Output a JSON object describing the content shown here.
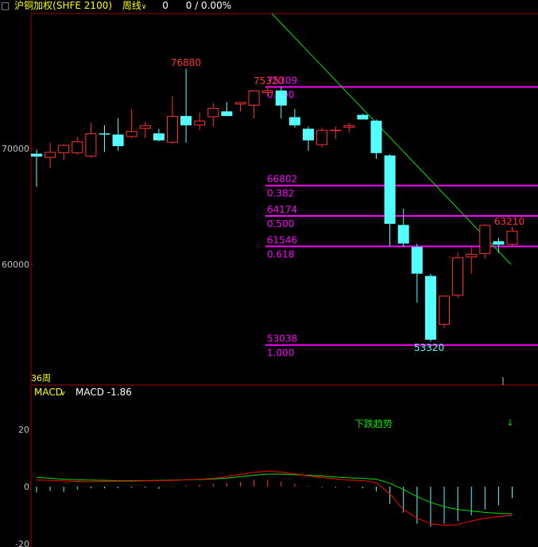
{
  "header": {
    "menu_glyph": "□",
    "symbol": "沪铜加权(SHFE 2100)",
    "period": "周线",
    "period_arrow": "chevron-down-icon",
    "volume": "0",
    "change": "0 / 0.00%"
  },
  "main": {
    "y_tick_labels": [
      "70000",
      "60000"
    ],
    "y_tick_values": [
      70000,
      60000
    ],
    "period_count_label": "36周",
    "annotations": {
      "high_label": "76880",
      "peak_label": "75320",
      "low_label": "53320",
      "last_label": "63210"
    }
  },
  "fib": [
    {
      "price": "75309",
      "ratio": "0.000",
      "value": 75309
    },
    {
      "price": "66802",
      "ratio": "0.382",
      "value": 66802
    },
    {
      "price": "64174",
      "ratio": "0.500",
      "value": 64174
    },
    {
      "price": "61546",
      "ratio": "0.618",
      "value": 61546
    },
    {
      "price": "53038",
      "ratio": "1.000",
      "value": 53038
    }
  ],
  "candles": [
    {
      "o": 69550,
      "h": 69900,
      "l": 66700,
      "c": 69300
    },
    {
      "o": 69200,
      "h": 70500,
      "l": 68300,
      "c": 69700
    },
    {
      "o": 69600,
      "h": 70400,
      "l": 69000,
      "c": 70300
    },
    {
      "o": 69600,
      "h": 71000,
      "l": 69500,
      "c": 70600
    },
    {
      "o": 69300,
      "h": 72200,
      "l": 69200,
      "c": 71300
    },
    {
      "o": 71300,
      "h": 72000,
      "l": 69700,
      "c": 71200
    },
    {
      "o": 71200,
      "h": 72600,
      "l": 69800,
      "c": 70200
    },
    {
      "o": 71000,
      "h": 73400,
      "l": 70900,
      "c": 71500
    },
    {
      "o": 71700,
      "h": 72300,
      "l": 70900,
      "c": 72000
    },
    {
      "o": 71300,
      "h": 71700,
      "l": 70600,
      "c": 70700
    },
    {
      "o": 70500,
      "h": 74500,
      "l": 70400,
      "c": 72800
    },
    {
      "o": 72800,
      "h": 76880,
      "l": 70500,
      "c": 72000
    },
    {
      "o": 72000,
      "h": 73100,
      "l": 71600,
      "c": 72400
    },
    {
      "o": 72700,
      "h": 73900,
      "l": 71900,
      "c": 73500
    },
    {
      "o": 73200,
      "h": 74000,
      "l": 72800,
      "c": 72800
    },
    {
      "o": 73800,
      "h": 74000,
      "l": 73200,
      "c": 74000
    },
    {
      "o": 73700,
      "h": 75000,
      "l": 72600,
      "c": 75000
    },
    {
      "o": 74800,
      "h": 75320,
      "l": 74600,
      "c": 75000
    },
    {
      "o": 75000,
      "h": 75300,
      "l": 72600,
      "c": 73700
    },
    {
      "o": 72700,
      "h": 73400,
      "l": 71800,
      "c": 72000
    },
    {
      "o": 71700,
      "h": 71900,
      "l": 69800,
      "c": 70700
    },
    {
      "o": 70300,
      "h": 71800,
      "l": 70100,
      "c": 71600
    },
    {
      "o": 71600,
      "h": 71900,
      "l": 70800,
      "c": 71600
    },
    {
      "o": 71800,
      "h": 72200,
      "l": 71400,
      "c": 72000
    },
    {
      "o": 72900,
      "h": 73000,
      "l": 72500,
      "c": 72500
    },
    {
      "o": 72400,
      "h": 72500,
      "l": 69100,
      "c": 69600
    },
    {
      "o": 69400,
      "h": 69500,
      "l": 61600,
      "c": 63500
    },
    {
      "o": 63400,
      "h": 64800,
      "l": 61500,
      "c": 61800
    },
    {
      "o": 61500,
      "h": 61800,
      "l": 56700,
      "c": 59200
    },
    {
      "o": 59000,
      "h": 59200,
      "l": 53320,
      "c": 53500
    },
    {
      "o": 54800,
      "h": 57300,
      "l": 54500,
      "c": 57300
    },
    {
      "o": 57300,
      "h": 61000,
      "l": 57100,
      "c": 60600
    },
    {
      "o": 60600,
      "h": 61600,
      "l": 59200,
      "c": 60900
    },
    {
      "o": 60900,
      "h": 63500,
      "l": 60500,
      "c": 63400
    },
    {
      "o": 62000,
      "h": 62300,
      "l": 61000,
      "c": 61700
    },
    {
      "o": 61700,
      "h": 63210,
      "l": 61600,
      "c": 62900
    }
  ],
  "macd": {
    "label": "MACD",
    "label_arrow": "chevron-down-icon",
    "value_text": "MACD -1.86",
    "y_tick_labels": [
      "20",
      "0",
      "-20"
    ],
    "y_tick_values": [
      20,
      0,
      -20
    ],
    "signal_text": "下跌趋势",
    "signal_icon": "arrow-down-icon",
    "hist": [
      -2,
      -1.5,
      -1.8,
      -1,
      -0.6,
      -0.6,
      -0.5,
      -0.4,
      -0.4,
      -0.8,
      0.2,
      0.5,
      0.8,
      1,
      1.3,
      1.6,
      2.4,
      2.4,
      1.8,
      1,
      0.3,
      -0.2,
      -0.3,
      -0.3,
      -0.6,
      -1.6,
      -6,
      -9,
      -13,
      -14,
      -13,
      -12,
      -10,
      -8,
      -6.5,
      -4
    ],
    "dif": [
      2.3,
      2.2,
      2,
      1.8,
      1.7,
      1.8,
      1.9,
      1.9,
      2,
      2.1,
      2.2,
      2.4,
      2.6,
      2.9,
      3.5,
      4.3,
      5,
      5.5,
      5.1,
      4.5,
      3.8,
      3.2,
      2.7,
      2.3,
      2.1,
      1.4,
      -2.5,
      -8,
      -11,
      -13,
      -13.5,
      -13.3,
      -12,
      -11,
      -10.5,
      -10
    ],
    "dea": [
      3.3,
      2.9,
      2.6,
      2.4,
      2.3,
      2.2,
      2.1,
      2.1,
      2.1,
      2.2,
      2.3,
      2.4,
      2.5,
      2.7,
      3,
      3.5,
      4,
      4.4,
      4.4,
      4.2,
      4,
      3.7,
      3.4,
      3.1,
      2.9,
      2.6,
      1.2,
      -1,
      -3.5,
      -5.5,
      -7,
      -8,
      -8.5,
      -9,
      -9.3,
      -9.5
    ]
  },
  "colors": {
    "up": "#ff3232",
    "down": "#54ffff",
    "fib": "#ff00ff",
    "trend": "#00e000",
    "axis": "#a00000",
    "dea": "#00e000",
    "dif": "#ff0000",
    "text_red": "#ff3232",
    "text_cyan": "#54ffff",
    "header_yellow": "#ffff00"
  }
}
